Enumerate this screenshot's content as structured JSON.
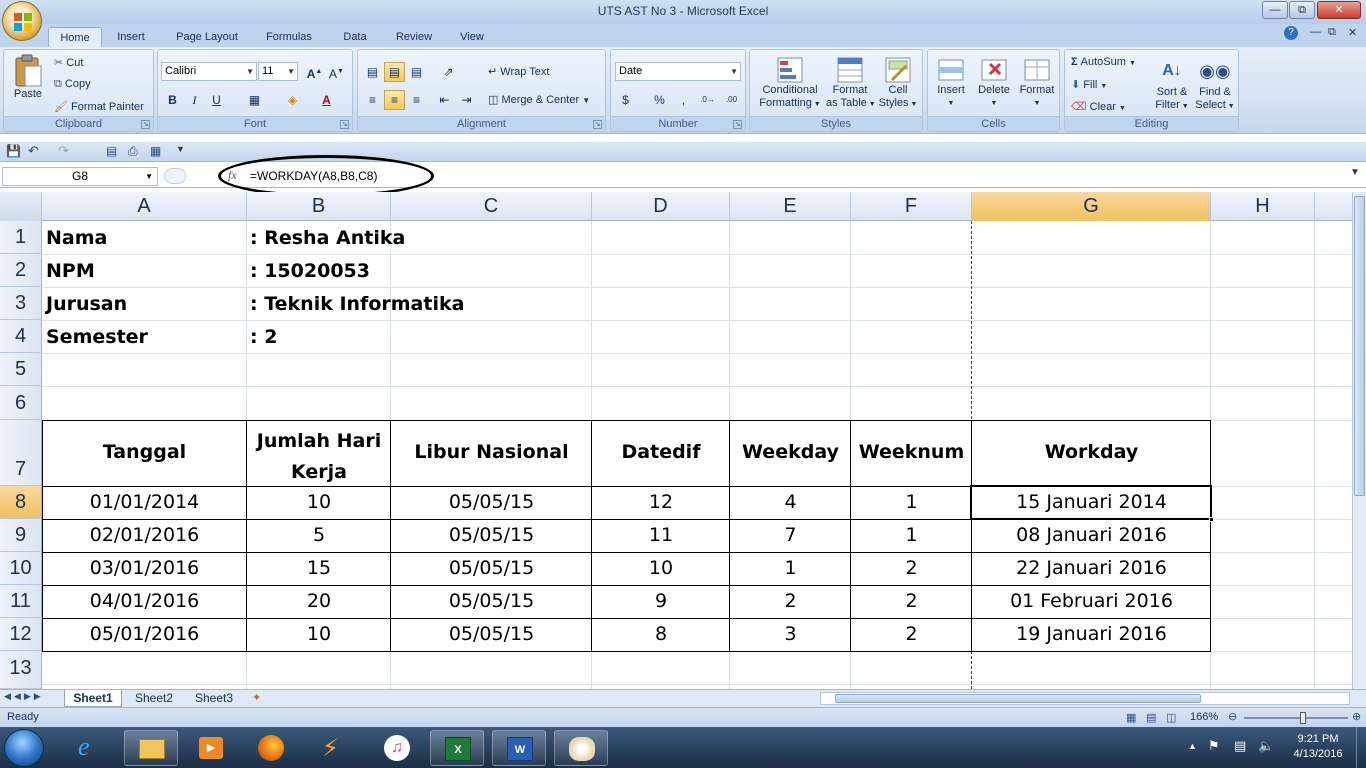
{
  "window": {
    "title": "UTS AST No 3 - Microsoft Excel"
  },
  "tabs": [
    "Home",
    "Insert",
    "Page Layout",
    "Formulas",
    "Data",
    "Review",
    "View"
  ],
  "ribbon": {
    "clipboard": {
      "label": "Clipboard",
      "paste": "Paste",
      "cut": "Cut",
      "copy": "Copy",
      "format_painter": "Format Painter"
    },
    "font": {
      "label": "Font",
      "font_name": "Calibri",
      "font_size": "11"
    },
    "alignment": {
      "label": "Alignment",
      "wrap_text": "Wrap Text",
      "merge_center": "Merge & Center"
    },
    "number": {
      "label": "Number",
      "format": "Date"
    },
    "styles": {
      "label": "Styles",
      "conditional": [
        "Conditional",
        "Formatting"
      ],
      "format_table": [
        "Format",
        "as Table"
      ],
      "cell_styles": [
        "Cell",
        "Styles"
      ]
    },
    "cells": {
      "label": "Cells",
      "insert": "Insert",
      "delete": "Delete",
      "format": "Format"
    },
    "editing": {
      "label": "Editing",
      "autosum": "AutoSum",
      "fill": "Fill",
      "clear": "Clear",
      "sort_filter": [
        "Sort &",
        "Filter"
      ],
      "find_select": [
        "Find &",
        "Select"
      ]
    }
  },
  "formula_bar": {
    "name_box": "G8",
    "formula": "=WORKDAY(A8,B8,C8)"
  },
  "columns": [
    "A",
    "B",
    "C",
    "D",
    "E",
    "F",
    "G",
    "H"
  ],
  "rows": [
    "1",
    "2",
    "3",
    "4",
    "5",
    "6",
    "7",
    "8",
    "9",
    "10",
    "11",
    "12",
    "13"
  ],
  "info": [
    {
      "label": "Nama",
      "value": ": Resha Antika"
    },
    {
      "label": "NPM",
      "value": ": 15020053"
    },
    {
      "label": "Jurusan",
      "value": ": Teknik Informatika"
    },
    {
      "label": "Semester",
      "value": ": 2"
    }
  ],
  "table": {
    "headers": [
      "Tanggal",
      "Jumlah Hari Kerja",
      "Libur Nasional",
      "Datedif",
      "Weekday",
      "Weeknum",
      "Workday"
    ],
    "header_b_lines": [
      "Jumlah Hari",
      "Kerja"
    ],
    "rows": [
      [
        "01/01/2014",
        "10",
        "05/05/15",
        "12",
        "4",
        "1",
        "15 Januari 2014"
      ],
      [
        "02/01/2016",
        "5",
        "05/05/15",
        "11",
        "7",
        "1",
        "08 Januari 2016"
      ],
      [
        "03/01/2016",
        "15",
        "05/05/15",
        "10",
        "1",
        "2",
        "22 Januari 2016"
      ],
      [
        "04/01/2016",
        "20",
        "05/05/15",
        "9",
        "2",
        "2",
        "01 Februari 2016"
      ],
      [
        "05/01/2016",
        "10",
        "05/05/15",
        "8",
        "3",
        "2",
        "19 Januari 2016"
      ]
    ]
  },
  "sheets": [
    "Sheet1",
    "Sheet2",
    "Sheet3"
  ],
  "status": {
    "ready": "Ready",
    "zoom": "166%"
  },
  "taskbar": {
    "time": "9:21 PM",
    "date": "4/13/2016"
  },
  "colors": {
    "selected_header": "#f1c15f",
    "ribbon_bg": "#d5e3f4",
    "accent": "#15316b"
  }
}
